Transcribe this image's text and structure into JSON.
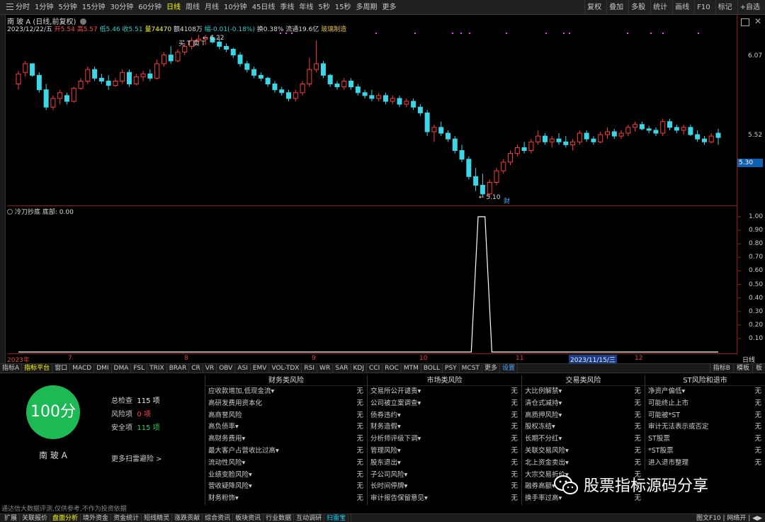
{
  "toolbar": {
    "periods": [
      "分时",
      "1分钟",
      "5分钟",
      "15分钟",
      "30分钟",
      "60分钟",
      "日线",
      "周线",
      "月线",
      "10分钟",
      "45日线",
      "季线",
      "年线",
      "5秒",
      "15秒",
      "多周期",
      "更多"
    ],
    "active_period": "日线",
    "right": [
      "复权",
      "叠加",
      "多股",
      "统计",
      "画线",
      "F10",
      "标记",
      "+自选"
    ]
  },
  "chart_header": {
    "stock_title": "南 玻 A (日线,前复权)",
    "date": "2023/12/22/五",
    "open_label": "开5.54",
    "high_label": "高5.57",
    "low_label": "低5.46",
    "close_label": "收5.51",
    "volume_label": "量74470",
    "amount_label": "额4108万",
    "change_label": "幅-0.01(-0.18%)",
    "turnover_label": "换0.38%",
    "float_label": "流通19.6亿",
    "sector_label": "玻璃制造"
  },
  "price_axis": {
    "labels": [
      "6.07",
      "5.52"
    ],
    "current": "5.30"
  },
  "chart_data": [
    {
      "type": "candlestick",
      "title": "南 玻 A (日线,前复权)",
      "y_labels": [
        "6.07",
        "5.52"
      ],
      "annotations": [
        "6.22",
        "5.10",
        "财"
      ],
      "current_price": "5.30",
      "ohlc": [
        [
          5.88,
          5.97,
          5.84,
          5.95
        ],
        [
          5.96,
          6.04,
          5.93,
          6.02
        ],
        [
          6.02,
          6.02,
          5.93,
          5.94
        ],
        [
          5.94,
          5.96,
          5.82,
          5.84
        ],
        [
          5.84,
          5.88,
          5.7,
          5.72
        ],
        [
          5.72,
          5.8,
          5.7,
          5.78
        ],
        [
          5.78,
          5.84,
          5.74,
          5.82
        ],
        [
          5.8,
          5.82,
          5.74,
          5.76
        ],
        [
          5.76,
          5.86,
          5.75,
          5.85
        ],
        [
          5.85,
          5.92,
          5.84,
          5.9
        ],
        [
          5.9,
          6.0,
          5.88,
          5.98
        ],
        [
          5.98,
          6.0,
          5.9,
          5.92
        ],
        [
          5.92,
          5.95,
          5.88,
          5.9
        ],
        [
          5.9,
          5.94,
          5.84,
          5.87
        ],
        [
          5.87,
          5.92,
          5.86,
          5.9
        ],
        [
          5.9,
          5.98,
          5.88,
          5.96
        ],
        [
          5.96,
          5.98,
          5.86,
          5.88
        ],
        [
          5.88,
          5.95,
          5.87,
          5.93
        ],
        [
          5.93,
          5.97,
          5.9,
          5.95
        ],
        [
          5.95,
          5.98,
          5.9,
          5.92
        ],
        [
          5.92,
          6.05,
          5.91,
          6.02
        ],
        [
          6.02,
          6.1,
          6.0,
          6.08
        ],
        [
          6.08,
          6.14,
          6.02,
          6.04
        ],
        [
          6.04,
          6.12,
          6.03,
          6.1
        ],
        [
          6.1,
          6.16,
          6.08,
          6.14
        ],
        [
          6.14,
          6.2,
          6.12,
          6.18
        ],
        [
          6.18,
          6.22,
          6.15,
          6.19
        ],
        [
          6.19,
          6.22,
          6.15,
          6.2
        ],
        [
          6.2,
          6.22,
          6.16,
          6.17
        ],
        [
          6.17,
          6.2,
          6.12,
          6.14
        ],
        [
          6.14,
          6.16,
          6.1,
          6.12
        ],
        [
          6.12,
          6.13,
          6.06,
          6.08
        ],
        [
          6.08,
          6.1,
          6.0,
          6.02
        ],
        [
          6.02,
          6.04,
          5.96,
          5.98
        ],
        [
          5.98,
          6.0,
          5.92,
          5.94
        ],
        [
          5.94,
          5.96,
          5.9,
          5.92
        ],
        [
          5.92,
          5.93,
          5.86,
          5.88
        ],
        [
          5.88,
          5.9,
          5.82,
          5.84
        ],
        [
          5.84,
          5.86,
          5.8,
          5.82
        ],
        [
          5.82,
          5.84,
          5.76,
          5.78
        ],
        [
          5.78,
          5.84,
          5.76,
          5.82
        ],
        [
          5.82,
          5.9,
          5.8,
          5.88
        ],
        [
          5.88,
          6.06,
          5.86,
          5.98
        ],
        [
          5.98,
          6.18,
          5.96,
          6.02
        ],
        [
          6.02,
          6.04,
          5.92,
          5.94
        ],
        [
          5.94,
          5.95,
          5.86,
          5.88
        ],
        [
          5.88,
          5.9,
          5.84,
          5.86
        ],
        [
          5.86,
          5.92,
          5.84,
          5.9
        ],
        [
          5.9,
          5.92,
          5.84,
          5.86
        ],
        [
          5.86,
          5.88,
          5.8,
          5.82
        ],
        [
          5.82,
          5.84,
          5.78,
          5.8
        ],
        [
          5.8,
          5.84,
          5.76,
          5.78
        ],
        [
          5.78,
          5.82,
          5.76,
          5.8
        ],
        [
          5.8,
          5.82,
          5.74,
          5.76
        ],
        [
          5.76,
          5.8,
          5.74,
          5.78
        ],
        [
          5.78,
          5.8,
          5.72,
          5.74
        ],
        [
          5.74,
          5.78,
          5.72,
          5.76
        ],
        [
          5.76,
          5.78,
          5.7,
          5.72
        ],
        [
          5.72,
          5.74,
          5.66,
          5.68
        ],
        [
          5.68,
          5.7,
          5.52,
          5.55
        ],
        [
          5.55,
          5.6,
          5.48,
          5.58
        ],
        [
          5.58,
          5.62,
          5.52,
          5.54
        ],
        [
          5.54,
          5.56,
          5.48,
          5.5
        ],
        [
          5.5,
          5.52,
          5.4,
          5.42
        ],
        [
          5.42,
          5.46,
          5.34,
          5.36
        ],
        [
          5.36,
          5.38,
          5.22,
          5.24
        ],
        [
          5.24,
          5.3,
          5.14,
          5.18
        ],
        [
          5.18,
          5.26,
          5.1,
          5.12
        ],
        [
          5.12,
          5.22,
          5.1,
          5.2
        ],
        [
          5.2,
          5.3,
          5.18,
          5.28
        ],
        [
          5.28,
          5.36,
          5.26,
          5.34
        ],
        [
          5.34,
          5.42,
          5.32,
          5.4
        ],
        [
          5.4,
          5.46,
          5.38,
          5.44
        ],
        [
          5.44,
          5.48,
          5.4,
          5.42
        ],
        [
          5.42,
          5.5,
          5.4,
          5.48
        ],
        [
          5.48,
          5.56,
          5.46,
          5.52
        ],
        [
          5.52,
          5.54,
          5.46,
          5.48
        ],
        [
          5.48,
          5.52,
          5.44,
          5.5
        ],
        [
          5.5,
          5.54,
          5.46,
          5.48
        ],
        [
          5.48,
          5.52,
          5.44,
          5.46
        ],
        [
          5.46,
          5.5,
          5.42,
          5.48
        ],
        [
          5.48,
          5.56,
          5.46,
          5.54
        ],
        [
          5.54,
          5.56,
          5.48,
          5.5
        ],
        [
          5.5,
          5.52,
          5.46,
          5.48
        ],
        [
          5.48,
          5.55,
          5.47,
          5.53
        ],
        [
          5.53,
          5.58,
          5.5,
          5.55
        ],
        [
          5.55,
          5.57,
          5.5,
          5.52
        ],
        [
          5.52,
          5.56,
          5.5,
          5.54
        ],
        [
          5.54,
          5.6,
          5.52,
          5.58
        ],
        [
          5.58,
          5.62,
          5.55,
          5.6
        ],
        [
          5.6,
          5.62,
          5.56,
          5.57
        ],
        [
          5.57,
          5.59,
          5.54,
          5.56
        ],
        [
          5.56,
          5.58,
          5.52,
          5.54
        ],
        [
          5.54,
          5.64,
          5.52,
          5.62
        ],
        [
          5.62,
          5.64,
          5.56,
          5.58
        ],
        [
          5.58,
          5.6,
          5.54,
          5.56
        ],
        [
          5.56,
          5.6,
          5.53,
          5.58
        ],
        [
          5.58,
          5.6,
          5.52,
          5.53
        ],
        [
          5.53,
          5.56,
          5.48,
          5.5
        ],
        [
          5.5,
          5.52,
          5.46,
          5.48
        ],
        [
          5.48,
          5.54,
          5.47,
          5.52
        ],
        [
          5.54,
          5.57,
          5.46,
          5.51
        ]
      ],
      "markers": [
        "买",
        "T",
        "卖",
        "T"
      ]
    },
    {
      "type": "line",
      "title": "冷刀抄底 底部: 0.00",
      "y_labels": [
        "1.00",
        "0.90",
        "0.80",
        "0.70",
        "0.60",
        "0.50",
        "0.40",
        "0.30",
        "0.20",
        "0.10"
      ],
      "ylim": [
        0,
        1
      ],
      "x_labels": [
        "2023年",
        "7",
        "8",
        "9",
        "10",
        "2023/11/15/三",
        "12"
      ],
      "values": [
        0,
        0,
        0,
        0,
        0,
        0,
        0,
        0,
        0,
        0,
        0,
        0,
        0,
        0,
        0,
        0,
        0,
        0,
        0,
        0,
        0,
        0,
        0,
        0,
        0,
        0,
        0,
        0,
        0,
        0,
        0,
        0,
        0,
        0,
        0,
        0,
        0,
        0,
        0,
        0,
        0,
        0,
        0,
        0,
        0,
        0,
        0,
        0,
        0,
        0,
        0,
        0,
        0,
        0,
        0,
        0,
        0,
        0,
        0,
        0,
        0,
        0,
        0,
        0,
        0,
        0,
        0,
        1,
        1,
        0,
        0,
        0,
        0,
        0,
        0,
        0,
        0,
        0,
        0,
        0,
        0,
        0,
        0,
        0,
        0,
        0,
        0,
        0,
        0,
        0,
        0,
        0,
        0,
        0,
        0,
        0,
        0,
        0,
        0,
        0,
        0,
        0,
        0
      ]
    }
  ],
  "indicator": {
    "name_label": "冷刀抄底 底部: 0.00"
  },
  "timeline": {
    "labels": [
      "2023年",
      "7",
      "8",
      "9",
      "10",
      "11",
      "2023/11/15/三",
      "12"
    ],
    "period": "日线"
  },
  "tabs": {
    "items": [
      "指标A",
      "指标平台",
      "窗口",
      "MACD",
      "DMI",
      "DMA",
      "FSL",
      "TRIX",
      "BRAR",
      "CR",
      "VR",
      "OBV",
      "ASI",
      "EMV",
      "VOL-TDX",
      "RSI",
      "WR",
      "SAR",
      "KDJ",
      "CCI",
      "ROC",
      "MTM",
      "BOLL",
      "PSY",
      "MCST",
      "更多",
      "设置"
    ],
    "right": [
      "指标B",
      "模板",
      "板"
    ]
  },
  "risk": {
    "score": "100分",
    "stock": "南 玻 A",
    "total_label": "总检查",
    "total_value": "115 项",
    "risk_label": "风险项",
    "risk_value": "0 项",
    "safe_label": "安全项",
    "safe_value": "115 项",
    "more": "更多扫雷避险 >",
    "cols": [
      {
        "title": "财务类风险",
        "items": [
          "应收款增加,低现金流▾",
          "高研发费用资本化",
          "高商誉风险",
          "高负债率▾",
          "高财务费用▾",
          "最大客户占营收比过高▾",
          "流动性风险▾",
          "业绩变脸风险▾",
          "营收疑降风险▾",
          "财务粉饰▾"
        ]
      },
      {
        "title": "市场类风险",
        "items": [
          "交易所公开谴责▾",
          "公司被立案调查▾",
          "债券违约▾",
          "财务造假▾",
          "分析师评级下调▾",
          "管理风险▾",
          "股东退出▾",
          "子公司风险▾",
          "长时间停牌▾",
          "审计报告保留意见▾"
        ]
      },
      {
        "title": "交易类风险",
        "items": [
          "大比例解禁▾",
          "清仓式减持▾",
          "高质押风险▾",
          "股权冻结▾",
          "长期不分红▾",
          "关联交易风险▾",
          "北上资金卖出▾",
          "大宗交易折价▾",
          "融券高额▾",
          "换手率过高▾"
        ]
      },
      {
        "title": "ST风险和退市",
        "items": [
          "净资产偏低▾",
          "可能终止上市",
          "可能被*ST",
          "审计无法表示或否定",
          "ST股票",
          "*ST股票",
          "进入退市整理"
        ]
      }
    ],
    "status": "无"
  },
  "disclaimer": "通达信大数据评测,仅供参考,不作为投资依据",
  "bottom_bar": {
    "items": [
      "扩展",
      "关联报价",
      "盘面分析",
      "境外资金",
      "资金统计",
      "短线精灵",
      "涨跌贡献",
      "综合资讯",
      "板块资讯",
      "行业数据",
      "互动调研",
      "扫雷宝"
    ],
    "right": "图文F10 | 网络开 | ◀▶"
  },
  "watermark": "股票指标源码分享",
  "colors": {
    "up": "#ff3b3b",
    "down": "#3dd6e6",
    "indicator": "#ffffff",
    "grid": "#8b1a1a"
  }
}
